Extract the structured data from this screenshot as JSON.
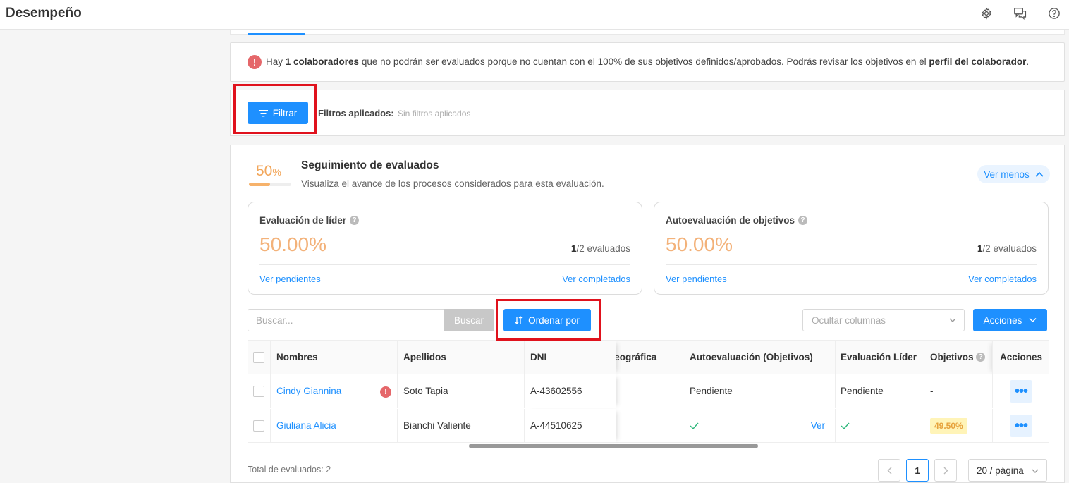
{
  "app": {
    "title": "Desempeño"
  },
  "topbar": {
    "icons": [
      "gear-icon",
      "chat-icon",
      "help-icon"
    ]
  },
  "warning": {
    "prefix": "Hay ",
    "link_text": "1 colaboradores",
    "middle": " que no podrán ser evaluados porque no cuentan con el 100% de sus objetivos definidos/aprobados. Podrás revisar los objetivos en el ",
    "bold_text": "perfil del colaborador",
    "suffix": "."
  },
  "filter": {
    "button_label": "Filtrar",
    "applied_label": "Filtros aplicados:",
    "applied_value": "Sin filtros aplicados"
  },
  "tracking": {
    "percent_value": "50",
    "percent_sign": "%",
    "progress": 0.5,
    "title": "Seguimiento de evaluados",
    "subtitle": "Visualiza el avance de los procesos considerados para esta evaluación.",
    "toggle_label": "Ver menos"
  },
  "stats": [
    {
      "title": "Evaluación de líder",
      "value": "50.00%",
      "done": "1",
      "total": "/2 evaluados",
      "pending_link": "Ver pendientes",
      "completed_link": "Ver completados"
    },
    {
      "title": "Autoevaluación de objetivos",
      "value": "50.00%",
      "done": "1",
      "total": "/2 evaluados",
      "pending_link": "Ver pendientes",
      "completed_link": "Ver completados"
    }
  ],
  "toolbar": {
    "search_placeholder": "Buscar...",
    "search_button": "Buscar",
    "order_button": "Ordenar por",
    "columns_placeholder": "Ocultar columnas",
    "actions_button": "Acciones"
  },
  "table": {
    "headers": {
      "nombres": "Nombres",
      "apellidos": "Apellidos",
      "dni": "DNI",
      "ubicacion": "n geográfica",
      "autoevaluacion": "Autoevaluación (Objetivos)",
      "evaluacion_lider": "Evaluación Líder",
      "objetivos": "Objetivos",
      "acciones": "Acciones"
    },
    "rows": [
      {
        "nombres": "Cindy Giannina",
        "apellidos": "Soto Tapia",
        "dni": "A-43602556",
        "autoevaluacion": "Pendiente",
        "ver": "",
        "evaluacion_lider": "Pendiente",
        "objetivos": "-",
        "has_alert": true,
        "auto_done": false,
        "lider_done": false
      },
      {
        "nombres": "Giuliana Alicia",
        "apellidos": "Bianchi Valiente",
        "dni": "A-44510625",
        "autoevaluacion": "",
        "ver": "Ver",
        "evaluacion_lider": "",
        "objetivos": "49.50%",
        "has_alert": false,
        "auto_done": true,
        "lider_done": true
      }
    ]
  },
  "footer": {
    "total_label": "Total de evaluados: 2",
    "current_page": "1",
    "page_size": "20 / página"
  },
  "colors": {
    "primary": "#1e90ff",
    "accent_orange": "#f3b27a",
    "alert_red": "#e5676a",
    "highlight_box": "#e0121d",
    "success_green": "#2db77b"
  }
}
